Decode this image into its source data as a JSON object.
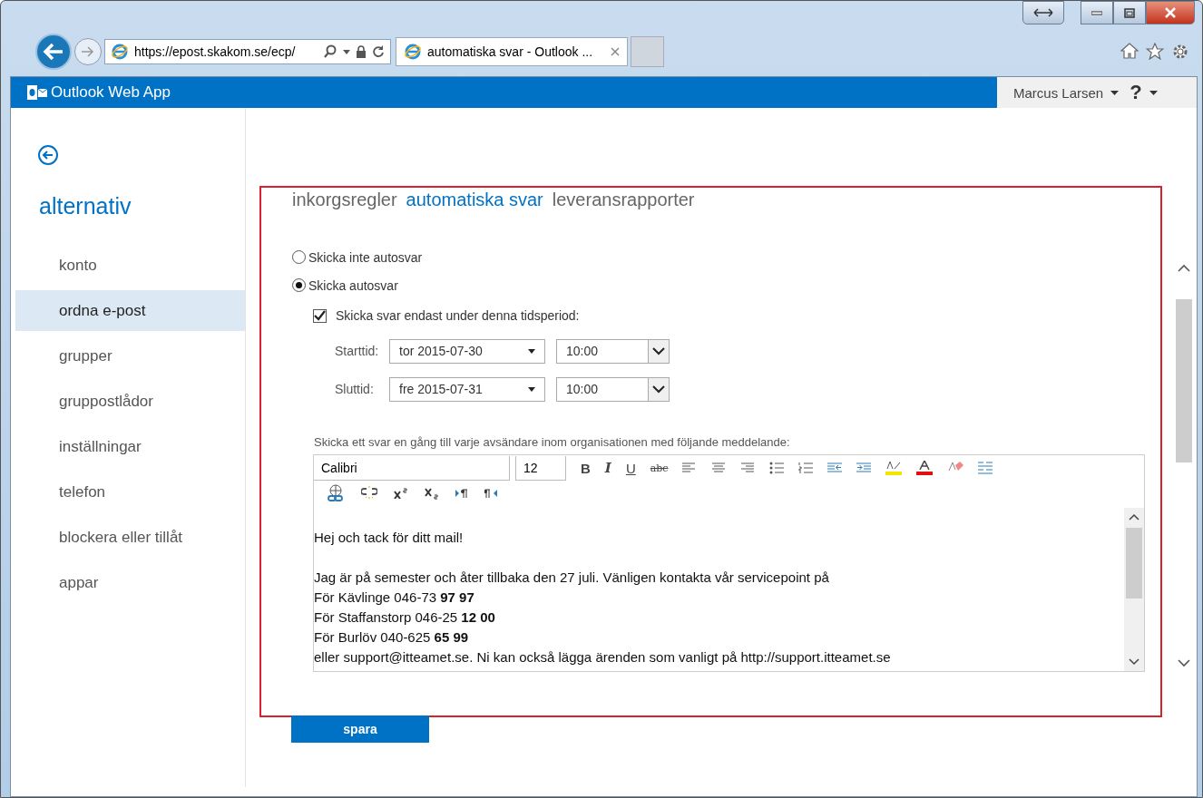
{
  "browser": {
    "address": "https://epost.skakom.se/ecp/",
    "tab_title": "automatiska svar - Outlook ..."
  },
  "app_bar": {
    "title": "Outlook Web App",
    "user": "Marcus Larsen",
    "help": "?"
  },
  "sidebar": {
    "title": "alternativ",
    "items": [
      {
        "label": "konto",
        "selected": false
      },
      {
        "label": "ordna e-post",
        "selected": true
      },
      {
        "label": "grupper",
        "selected": false
      },
      {
        "label": "gruppostlådor",
        "selected": false
      },
      {
        "label": "inställningar",
        "selected": false
      },
      {
        "label": "telefon",
        "selected": false
      },
      {
        "label": "blockera eller tillåt",
        "selected": false
      },
      {
        "label": "appar",
        "selected": false
      }
    ]
  },
  "tabs": [
    {
      "label": "inkorgsregler",
      "selected": false
    },
    {
      "label": "automatiska svar",
      "selected": true
    },
    {
      "label": "leveransrapporter",
      "selected": false
    }
  ],
  "options": [
    {
      "label": "Skicka inte autosvar",
      "selected": false
    },
    {
      "label": "Skicka autosvar",
      "selected": true
    }
  ],
  "period": {
    "label": "Skicka svar endast under denna tidsperiod:",
    "checked": true,
    "rows": [
      {
        "label": "Starttid:",
        "date": "tor 2015-07-30",
        "time": "10:00"
      },
      {
        "label": "Sluttid:",
        "date": "fre 2015-07-31",
        "time": "10:00"
      }
    ]
  },
  "message_label": "Skicka ett svar en gång till varje avsändare inom organisationen med följande meddelande:",
  "editor": {
    "font": "Calibri",
    "size": "12",
    "format_buttons": [
      "B",
      "I",
      "U",
      "abc"
    ],
    "paragraphs": [
      [
        "Hej och tack för ditt mail!"
      ],
      [
        "Jag är på semester och åter tillbaka den 27 juli. Vänligen kontakta vår servicepoint på",
        "För Kävlinge 046-73 **97 97**",
        "För Staffanstorp 046-25 **12 00**",
        "För Burlöv 040-625 **65 99**",
        "eller support@itteamet.se. Ni kan också lägga ärenden som vanligt på http://support.itteamet.se"
      ]
    ]
  },
  "save_button": "spara"
}
